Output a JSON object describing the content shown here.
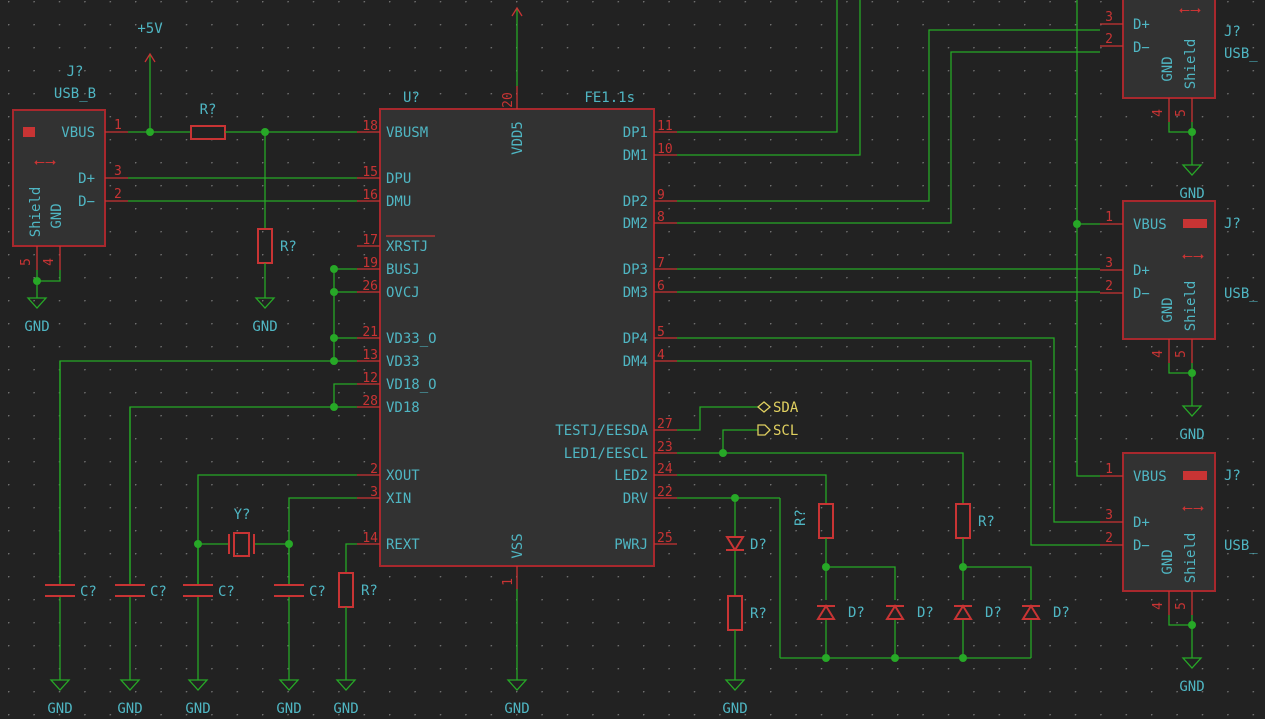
{
  "power": {
    "vcc": "+5V",
    "gnd": "GND"
  },
  "hub": {
    "ref": "U?",
    "value": "FE1.1s",
    "left_pins": [
      {
        "num": "18",
        "name": "VBUSM"
      },
      {
        "num": "15",
        "name": "DPU"
      },
      {
        "num": "16",
        "name": "DMU"
      },
      {
        "num": "17",
        "name": "XRSTJ"
      },
      {
        "num": "19",
        "name": "BUSJ"
      },
      {
        "num": "26",
        "name": "OVCJ"
      },
      {
        "num": "21",
        "name": "VD33_O"
      },
      {
        "num": "13",
        "name": "VD33"
      },
      {
        "num": "12",
        "name": "VD18_O"
      },
      {
        "num": "28",
        "name": "VD18"
      },
      {
        "num": "2",
        "name": "XOUT"
      },
      {
        "num": "3",
        "name": "XIN"
      },
      {
        "num": "14",
        "name": "REXT"
      }
    ],
    "right_pins": [
      {
        "num": "11",
        "name": "DP1"
      },
      {
        "num": "10",
        "name": "DM1"
      },
      {
        "num": "9",
        "name": "DP2"
      },
      {
        "num": "8",
        "name": "DM2"
      },
      {
        "num": "7",
        "name": "DP3"
      },
      {
        "num": "6",
        "name": "DM3"
      },
      {
        "num": "5",
        "name": "DP4"
      },
      {
        "num": "4",
        "name": "DM4"
      },
      {
        "num": "27",
        "name": "TESTJ/EESDA"
      },
      {
        "num": "23",
        "name": "LED1/EESCL"
      },
      {
        "num": "24",
        "name": "LED2"
      },
      {
        "num": "22",
        "name": "DRV"
      },
      {
        "num": "25",
        "name": "PWRJ"
      }
    ],
    "top_pin": {
      "num": "20",
      "name": "VDD5"
    },
    "bottom_pin": {
      "num": "1",
      "name": "VSS"
    }
  },
  "usb_b": {
    "ref": "J?",
    "value": "USB_B",
    "pins": [
      {
        "num": "1",
        "name": "VBUS"
      },
      {
        "num": "3",
        "name": "D+"
      },
      {
        "num": "2",
        "name": "D−"
      }
    ],
    "bottom": [
      {
        "num": "5",
        "name": "Shield"
      },
      {
        "num": "4",
        "name": "GND"
      }
    ]
  },
  "usb_a": {
    "ref": "J?",
    "value": "USB_",
    "pins": [
      {
        "num": "1",
        "name": "VBUS"
      },
      {
        "num": "3",
        "name": "D+"
      },
      {
        "num": "2",
        "name": "D−"
      }
    ],
    "bottom": [
      {
        "num": "4",
        "name": "GND"
      },
      {
        "num": "5",
        "name": "Shield"
      }
    ]
  },
  "labels": {
    "sda": "SDA",
    "scl": "SCL"
  },
  "passives": {
    "resistor": "R?",
    "capacitor": "C?",
    "diode": "D?",
    "crystal": "Y?"
  }
}
